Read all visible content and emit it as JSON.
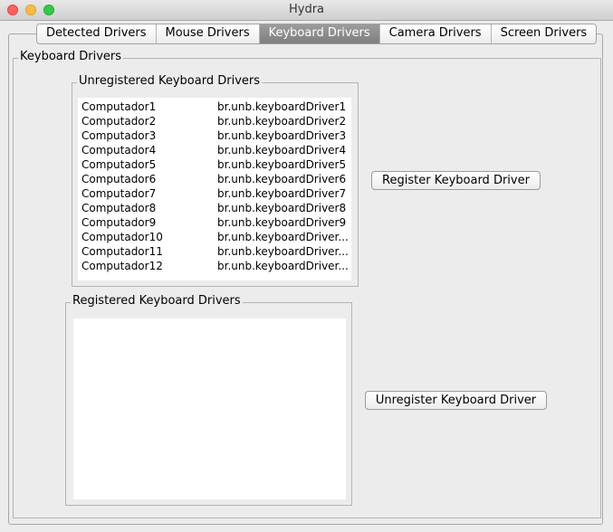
{
  "window": {
    "title": "Hydra"
  },
  "tabs": [
    {
      "label": "Detected Drivers"
    },
    {
      "label": "Mouse Drivers"
    },
    {
      "label": "Keyboard Drivers",
      "selected": true
    },
    {
      "label": "Camera Drivers"
    },
    {
      "label": "Screen Drivers"
    }
  ],
  "panel": {
    "title": "Keyboard Drivers"
  },
  "unregistered": {
    "title": "Unregistered Keyboard Drivers",
    "rows": [
      {
        "name": "Computador1",
        "driver": "br.unb.keyboardDriver1"
      },
      {
        "name": "Computador2",
        "driver": "br.unb.keyboardDriver2"
      },
      {
        "name": "Computador3",
        "driver": "br.unb.keyboardDriver3"
      },
      {
        "name": "Computador4",
        "driver": "br.unb.keyboardDriver4"
      },
      {
        "name": "Computador5",
        "driver": "br.unb.keyboardDriver5"
      },
      {
        "name": "Computador6",
        "driver": "br.unb.keyboardDriver6"
      },
      {
        "name": "Computador7",
        "driver": "br.unb.keyboardDriver7"
      },
      {
        "name": "Computador8",
        "driver": "br.unb.keyboardDriver8"
      },
      {
        "name": "Computador9",
        "driver": "br.unb.keyboardDriver9"
      },
      {
        "name": "Computador10",
        "driver": "br.unb.keyboardDriver..."
      },
      {
        "name": "Computador11",
        "driver": "br.unb.keyboardDriver..."
      },
      {
        "name": "Computador12",
        "driver": "br.unb.keyboardDriver..."
      }
    ]
  },
  "registered": {
    "title": "Registered Keyboard Drivers",
    "rows": []
  },
  "buttons": {
    "register": "Register Keyboard Driver",
    "unregister": "Unregister Keyboard Driver"
  }
}
